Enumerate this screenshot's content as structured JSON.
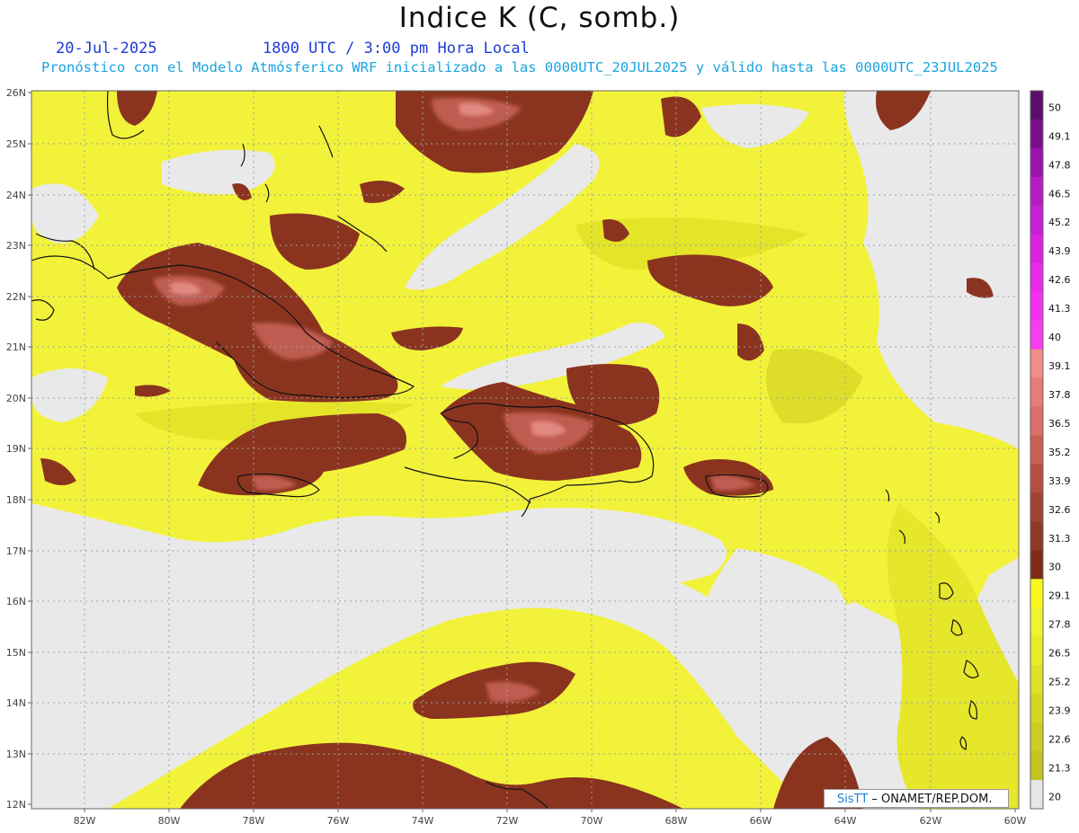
{
  "header": {
    "title": "Indice K (C, somb.)",
    "date": "20-Jul-2025",
    "time": "1800 UTC / 3:00 pm Hora Local",
    "description": "Pronóstico con el Modelo Atmósferico WRF inicializado a las 0000UTC_20JUL2025 y válido hasta las  0000UTC_23JUL2025"
  },
  "map": {
    "lat_labels": [
      "26N",
      "25N",
      "24N",
      "23N",
      "22N",
      "21N",
      "20N",
      "19N",
      "18N",
      "17N",
      "16N",
      "15N",
      "14N",
      "13N",
      "12N"
    ],
    "lon_labels": [
      "82W",
      "80W",
      "78W",
      "76W",
      "74W",
      "72W",
      "70W",
      "68W",
      "66W",
      "64W",
      "62W",
      "60W"
    ],
    "colors": {
      "ocean_gray": "#e9e9e9",
      "yellow_light": "#f2f23a",
      "yellow_mid": "#e6e62a",
      "yellow_olive": "#cfcf22",
      "brown_dark": "#8a3420",
      "brown_mid": "#a04a34",
      "salmon": "#d9736a",
      "pink": "#e8928a",
      "coast": "#111111",
      "grid": "#9aa0a6"
    }
  },
  "colorbar": {
    "labels": [
      "50",
      "49.1",
      "47.8",
      "46.5",
      "45.2",
      "43.9",
      "42.6",
      "41.3",
      "40",
      "39.1",
      "37.8",
      "36.5",
      "35.2",
      "33.9",
      "32.6",
      "31.3",
      "30",
      "29.1",
      "27.8",
      "26.5",
      "25.2",
      "23.9",
      "22.6",
      "21.3",
      "20"
    ],
    "colors": [
      "#5a0e6b",
      "#7a0f8c",
      "#9b12ad",
      "#b51cc5",
      "#c81ed4",
      "#dc22e0",
      "#ea2ae8",
      "#f530ee",
      "#f83cf2",
      "#f08d86",
      "#e57d75",
      "#db6f68",
      "#c95e52",
      "#b44f40",
      "#9f4432",
      "#8d3a24",
      "#7e2c18",
      "#f8f820",
      "#f2f22c",
      "#eaea2a",
      "#e0e026",
      "#d6d624",
      "#cdcd22",
      "#c4c41f",
      "#e6e6e6"
    ]
  },
  "credit": {
    "brand": "SisTT",
    "org": " – ONAMET/REP.DOM."
  }
}
